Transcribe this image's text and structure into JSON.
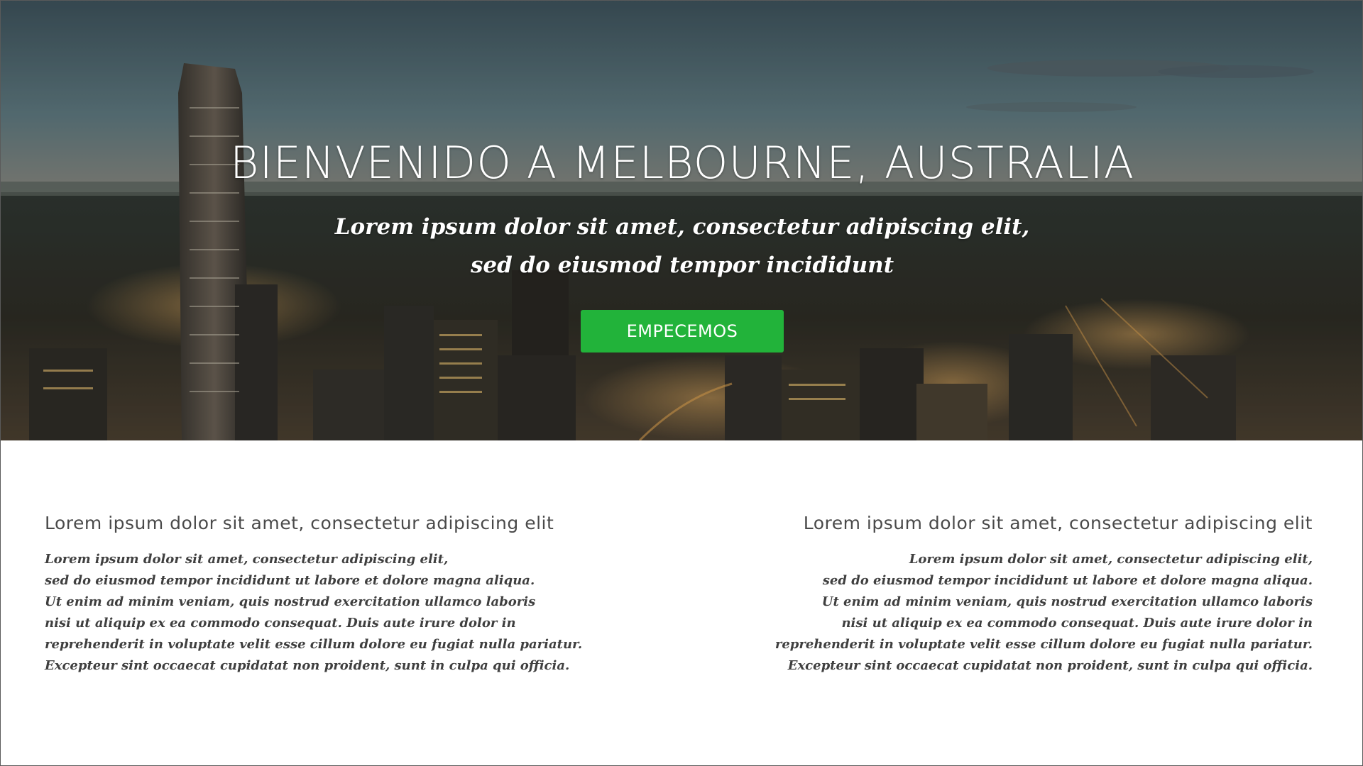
{
  "hero": {
    "title": "BIENVENIDO A MELBOURNE, AUSTRALIA",
    "subtitle_lines": [
      "Lorem ipsum dolor sit amet, consectetur adipiscing elit,",
      "sed do eiusmod tempor incididunt"
    ],
    "cta_label": "EMPECEMOS"
  },
  "sections": [
    {
      "heading": "Lorem ipsum dolor sit amet, consectetur adipiscing elit",
      "lines": [
        "Lorem ipsum dolor sit amet, consectetur adipiscing elit,",
        "sed do eiusmod tempor incididunt ut labore et dolore magna aliqua.",
        "Ut enim ad minim veniam, quis nostrud exercitation ullamco laboris",
        "nisi ut aliquip ex ea commodo consequat. Duis aute irure dolor in",
        "reprehenderit in voluptate velit esse cillum dolore eu fugiat nulla pariatur.",
        "Excepteur sint occaecat cupidatat non proident, sunt in culpa qui officia."
      ]
    },
    {
      "heading": "Lorem ipsum dolor sit amet, consectetur adipiscing elit",
      "lines": [
        "Lorem ipsum dolor sit amet, consectetur adipiscing elit,",
        "sed do eiusmod tempor incididunt ut labore et dolore magna aliqua.",
        "Ut enim ad minim veniam, quis nostrud exercitation ullamco laboris",
        "nisi ut aliquip ex ea commodo consequat. Duis aute irure dolor in",
        "reprehenderit in voluptate velit esse cillum dolore eu fugiat nulla pariatur.",
        "Excepteur sint occaecat cupidatat non proident, sunt in culpa qui officia."
      ]
    }
  ],
  "colors": {
    "cta_background": "#22b33a",
    "heading_text": "#4a4a4a",
    "body_text": "#3f3f3f"
  },
  "images": {
    "hero_background": "melbourne-skyline-at-dusk"
  }
}
